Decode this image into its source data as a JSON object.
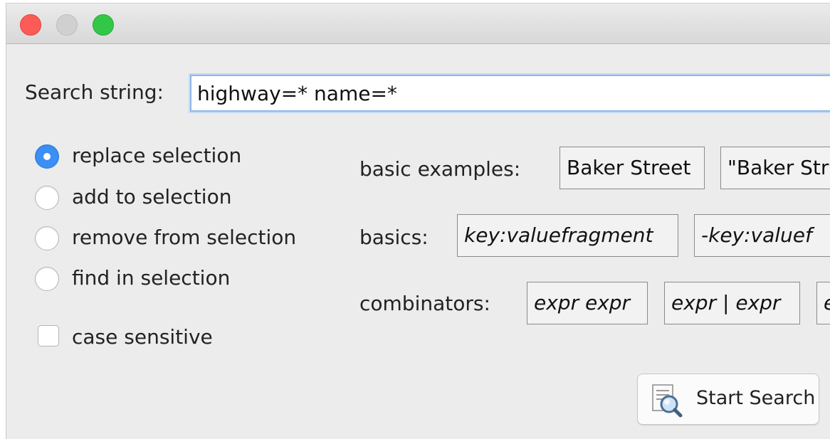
{
  "search": {
    "label": "Search string:",
    "value": "highway=* name=*"
  },
  "modes": [
    {
      "label": "replace selection",
      "selected": true
    },
    {
      "label": "add to selection",
      "selected": false
    },
    {
      "label": "remove from selection",
      "selected": false
    },
    {
      "label": "find in selection",
      "selected": false
    }
  ],
  "case_sensitive": {
    "label": "case sensitive",
    "checked": false
  },
  "examples": {
    "basic_label": "basic examples:",
    "basic_chips": [
      "Baker Street",
      "\"Baker Str"
    ],
    "basics_label": "basics:",
    "basics_chips": [
      "key:valuefragment",
      "-key:valuef"
    ],
    "combinators_label": "combinators:",
    "combinators_chips": [
      "expr expr",
      "expr | expr",
      "e"
    ]
  },
  "start_button": {
    "label": "Start Search",
    "icon": "magnifier-document-icon"
  },
  "colors": {
    "accent": "#3b8ff5",
    "close": "#fc5b57",
    "maximize": "#33c748"
  }
}
